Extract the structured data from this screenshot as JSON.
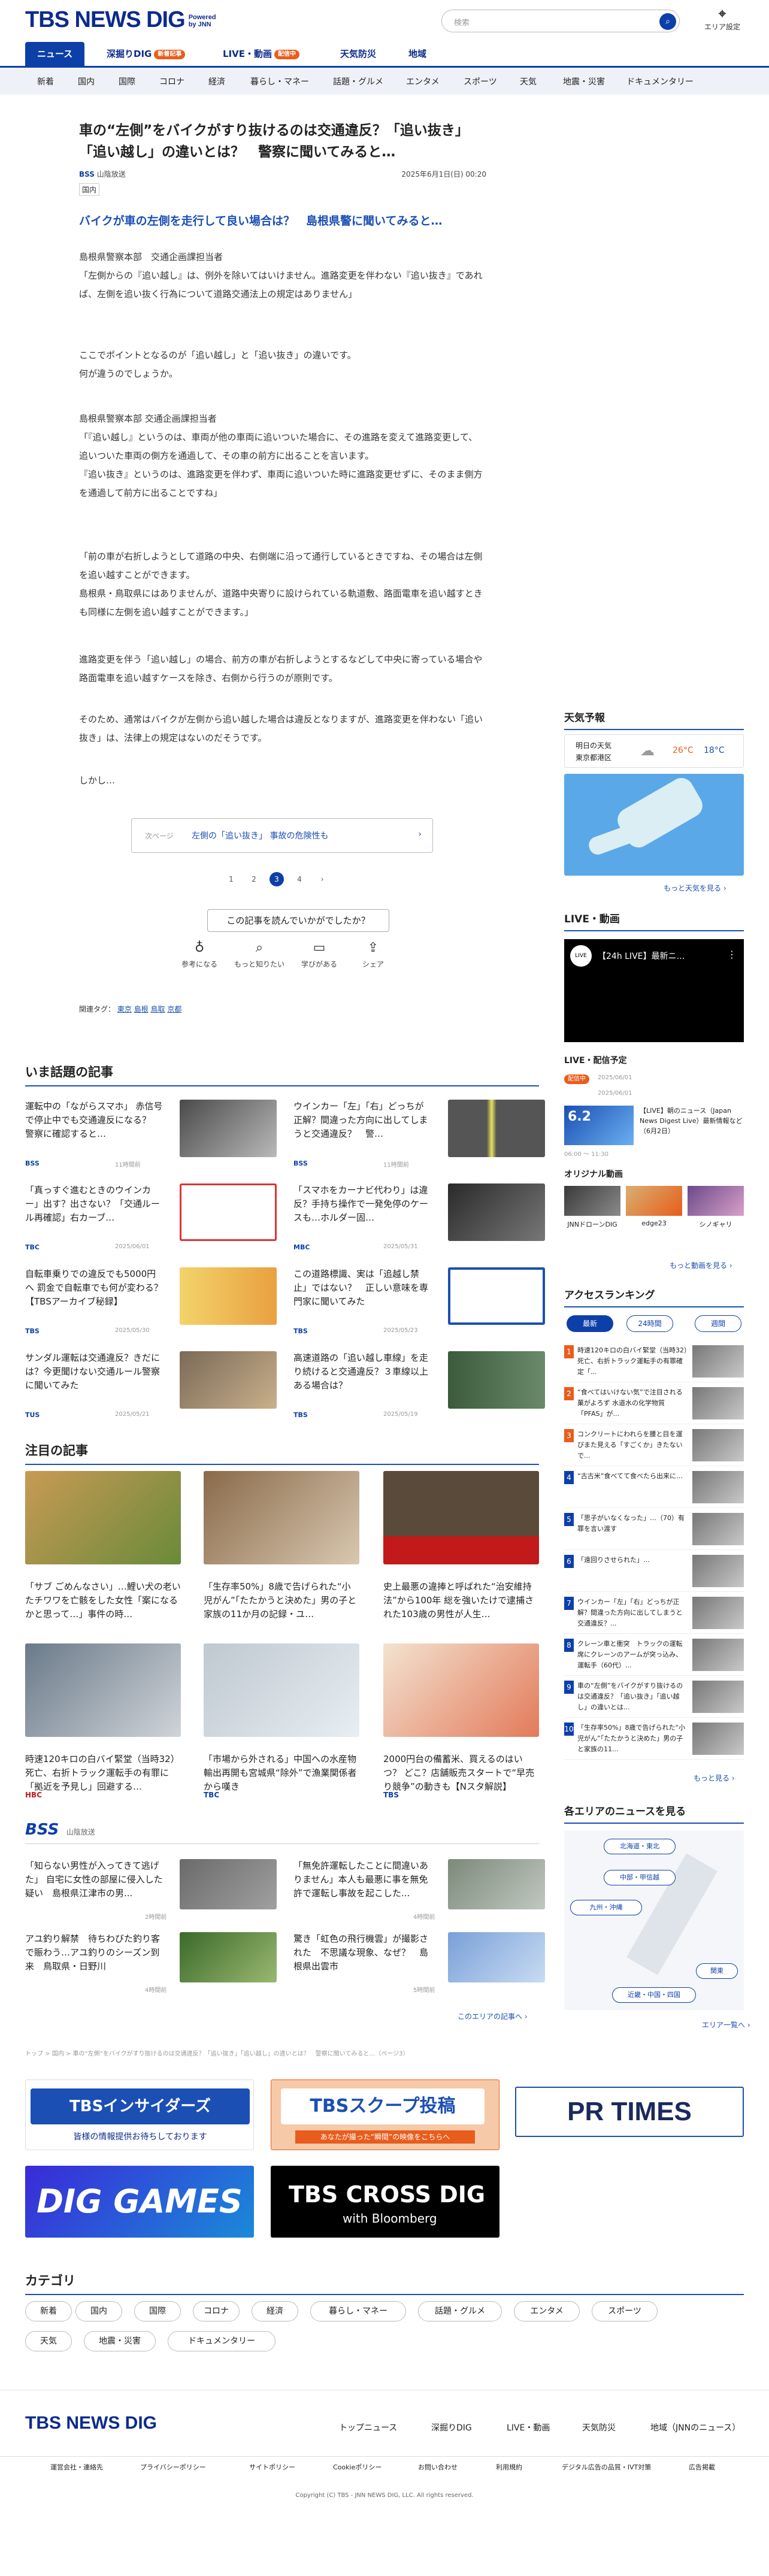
{
  "header": {
    "logo": "TBS NEWS DIG",
    "logo_sub": "Powered by JNN",
    "search_placeholder": "検索",
    "area_label": "エリア設定"
  },
  "nav_main": [
    {
      "label": "ニュース"
    },
    {
      "label": "深掘りDIG",
      "badge": "新着記事"
    },
    {
      "label": "LIVE・動画",
      "badge": "配信中"
    },
    {
      "label": "天気防災"
    },
    {
      "label": "地域"
    }
  ],
  "nav_sub": [
    "新着",
    "国内",
    "国際",
    "コロナ",
    "経済",
    "暮らし・マネー",
    "話題・グルメ",
    "エンタメ",
    "スポーツ",
    "天気",
    "地震・災害",
    "ドキュメンタリー"
  ],
  "article": {
    "title": "車の“左側”をバイクがすり抜けるのは交通違反？「追い抜き」「追い越し」の違いとは？　警察に聞いてみると…",
    "source": "BSS",
    "source_name": "山陰放送",
    "date": "2025年6月1日(日) 00:20",
    "category": "国内",
    "headline": "バイクが車の左側を走行して良い場合は？　島根県警に聞いてみると…",
    "paragraphs": [
      "島根県警察本部　交通企画課担当者\n「左側からの『追い越し』は、例外を除いてはいけません。進路変更を伴わない『追い抜き』であれば、左側を追い抜く行為について道路交通法上の規定はありません」",
      "ここでポイントとなるのが「追い越し」と「追い抜き」の違いです。\n何が違うのでしょうか。",
      "島根県警察本部 交通企画課担当者\n「『追い越し』というのは、車両が他の車両に追いついた場合に、その進路を変えて進路変更して、追いついた車両の側方を通過して、その車の前方に出ることを言います。\n『追い抜き』というのは、進路変更を伴わず、車両に追いついた時に進路変更せずに、そのまま側方を通過して前方に出ることですね」",
      "「前の車が右折しようとして道路の中央、右側端に沿って通行しているときですね、その場合は左側を追い越すことができます。\n島根県・鳥取県にはありませんが、道路中央寄りに設けられている軌道敷、路面電車を追い越すときも同様に左側を追い越すことができます。」",
      "進路変更を伴う「追い越し」の場合、前方の車が右折しようとするなどして中央に寄っている場合や路面電車を追い越すケースを除き、右側から行うのが原則です。",
      "そのため、通常はバイクが左側から追い越した場合は違反となりますが、進路変更を伴わない「追い抜き」は、法律上の規定はないのだそうです。",
      "しかし…"
    ],
    "next_label": "次ページ",
    "next_title": "左側の「追い抜き」 事故の危険性も",
    "pages": [
      "1",
      "2",
      "3",
      "4"
    ],
    "current_page": "3",
    "ask": "この記事を読んでいかがでしたか？",
    "reactions": [
      "参考になる",
      "もっと知りたい",
      "学びがある",
      "シェア"
    ],
    "tags_label": "関連タグ：",
    "tags": [
      "東京",
      "島根",
      "鳥取",
      "京都"
    ]
  },
  "hot": {
    "heading": "いま話題の記事",
    "items": [
      {
        "title": "運転中の「ながらスマホ」 赤信号で停止中でも交通違反になる？　警察に確認すると…",
        "src": "BSS",
        "date": "11時間前"
      },
      {
        "title": "ウインカー「左」「右」どっちが正解？間違った方向に出してしまうと交通違反？　警…",
        "src": "BSS",
        "date": "11時間前"
      },
      {
        "title": "「真っすぐ進むときのウインカー」出す？出さない？「交通ルール再確認」右カーブ…",
        "src": "TBC",
        "date": "2025/06/01"
      },
      {
        "title": "「スマホをカーナビ代わり」は違反？手持ち操作で一発免停のケースも…ホルダー固…",
        "src": "MBC",
        "date": "2025/05/31"
      },
      {
        "title": "自転車乗りでの違反でも5000円へ 罰金で自転車でも何が変わる？【TBSアーカイブ秘録】",
        "src": "TBS",
        "date": "2025/05/30"
      },
      {
        "title": "この道路標識、実は「追越し禁止」ではない？　正しい意味を専門家に聞いてみた",
        "src": "TBS",
        "date": "2025/05/23"
      },
      {
        "title": "サンダル運転は交通違反？きだには？今更聞けない交通ルール警察に聞いてみた",
        "src": "TUS",
        "date": "2025/05/21"
      },
      {
        "title": "高速道路の「追い越し車線」を走り続けると交通違反？３車線以上ある場合は？",
        "src": "TBS",
        "date": "2025/05/19"
      }
    ]
  },
  "featured": {
    "heading": "注目の記事",
    "items": [
      {
        "title": "「サブ ごめんなさい」…鯉い犬の老いたチワワを亡骸をした女性「案になるかと思って…」事件の時…",
        "src": "ニッポンの",
        "date": "2025/05/31"
      },
      {
        "title": "「生存率50%」8歳で告げられた“小児がん”「たたかうと決めた」男の子と家族の11か月の記録・ユ…",
        "src": "CBC TV",
        "date": "2025/05/31"
      },
      {
        "title": "史上最悪の違捧と呼ばれた“治安維持法”から100年 総を強いたけで逮捕された103歳の男性が人生…",
        "src": "HBC",
        "date": "2025/06/01"
      },
      {
        "title": "時速120キロの白バイ緊堂（当時32）死亡、右折トラック運転手の有罪に「拠近を予見し」回避する…",
        "src": "HBC",
        "date": "2025/05/29"
      },
      {
        "title": "「市場から外される」中国への水産物輸出再開も宮城県“除外”で漁業関係者から嘆き",
        "src": "TBC",
        "date": "2025/06/01"
      },
      {
        "title": "2000円台の備蓄米、買えるのはいつ？ どこ？店舗販売スタートで“早売り競争”の動きも【Nスタ解説】",
        "src": "TBS",
        "date": "2025/05/30"
      }
    ]
  },
  "local": {
    "heading": "BSS",
    "sub": "山陰放送",
    "items": [
      {
        "title": "「知らない男性が入ってきて逃げた」 自宅に女性の部屋に侵入した疑い　島根県江津市の男...",
        "date": "2時間前"
      },
      {
        "title": "「無免許運転したことに間違いありません」本人も最悪に事を無免許で運転し事故を起こした...",
        "date": "4時間前"
      },
      {
        "title": "アユ釣り解禁　待ちわびた釣り客で賑わう…アユ釣りのシーズン到来　鳥取県・日野川",
        "date": "4時間前"
      },
      {
        "title": "驚き「虹色の飛行機雲」が撮影された　不思議な現象、なぜ？　島根県出雲市",
        "date": "5時間前"
      }
    ],
    "more": "このエリアの記事へ"
  },
  "breadcrumb": "トップ > 国内 > 車の“左側”をバイクがすり抜けるのは交通違反？「追い抜き」「追い越し」の違いとは？　警察に聞いてみると…（ページ3）",
  "banners": [
    "TBSインサイダーズ",
    "皆様の情報提供お待ちしております",
    "TBSスクープ投稿",
    "あなたが撮った“瞬間”の映像をこちらへ",
    "PR TIMES",
    "DIG GAMES",
    "TBS CROSS DIG",
    "with Bloomberg"
  ],
  "categories": {
    "heading": "カテゴリ",
    "items": [
      "新着",
      "国内",
      "国際",
      "コロナ",
      "経済",
      "暮らし・マネー",
      "話題・グルメ",
      "エンタメ",
      "スポーツ",
      "天気",
      "地震・災害",
      "ドキュメンタリー"
    ]
  },
  "footer": {
    "links": [
      "トップニュース",
      "深掘りDIG",
      "LIVE・動画",
      "天気防災",
      "地域（JNNのニュース）"
    ],
    "sublinks": [
      "運営会社・連絡先",
      "プライバシーポリシー",
      "サイトポリシー",
      "Cookieポリシー",
      "お問い合わせ",
      "利用規約",
      "デジタル広告の品質・IVT対策",
      "広告掲載"
    ],
    "copyright": "Copyright (C) TBS - JNN NEWS DIG, LLC. All rights reserved."
  },
  "sidebar": {
    "weather": {
      "heading": "天気予報",
      "day": "明日の天気",
      "place": "東京都港区",
      "hi": "26°C",
      "lo": "18°C",
      "more": "もっと天気を見る"
    },
    "live": {
      "heading": "LIVE・動画",
      "video_title": "【24h LIVE】最新ニ…",
      "sched_label": "LIVE・配信予定",
      "live_badge": "配信中",
      "date1": "2025/06/01",
      "date2": "2025/06/01",
      "item1": "【LIVE】朝のニュース（Japan News Digest Live）最新情報など（6月2日）",
      "item1_time": "06:00 ～ 11:30",
      "orig": "オリジナル動画",
      "orig_items": [
        "JNNドローンDIG",
        "edge23",
        "シノギャリ"
      ],
      "more": "もっと動画を見る"
    },
    "ranking": {
      "heading": "アクセスランキング",
      "tabs": [
        "最新",
        "24時間",
        "週間"
      ],
      "items": [
        "時速120キロの白バイ緊堂（当時32）死亡、右折トラック運転手の有罪確定「...",
        "“食べてはいけない気”で注目される菓がよろず 水道水の化学物質「PFAS」が...",
        "コンクリートにわれらを腰と目を運びまた見える「すごくか」きたないで...",
        "“古古米”食べてて食べたら出来に…",
        "「思子がいなくなった」…（70）有罪を言い渡す",
        "「遠回りさせられた」…",
        "ウインカー「左」「右」どっちが正解？間違った方向に出してしまうと交通違反？...",
        "クレーン車と衝突　トラックの運転席にクレーンのアームが突っ込み、運転手（60代）...",
        "車の“左側”をバイクがすり抜けるのは交通違反？「追い抜き」「追い越し」の違いとは...",
        "「生存率50%」8歳で告げられた“小児がん”「たたかうと決めた」男の子と家族の11..."
      ],
      "more": "もっと見る"
    },
    "areas": {
      "heading": "各エリアのニュースを見る",
      "items": [
        "北海道・東北",
        "中部・甲信越",
        "九州・沖縄",
        "関東",
        "近畿・中国・四国"
      ],
      "more": "エリア一覧へ"
    }
  },
  "colors": {
    "brand": "#0d3fa8",
    "accent_orange": "#e85d1c",
    "link": "#1b4fb3"
  }
}
